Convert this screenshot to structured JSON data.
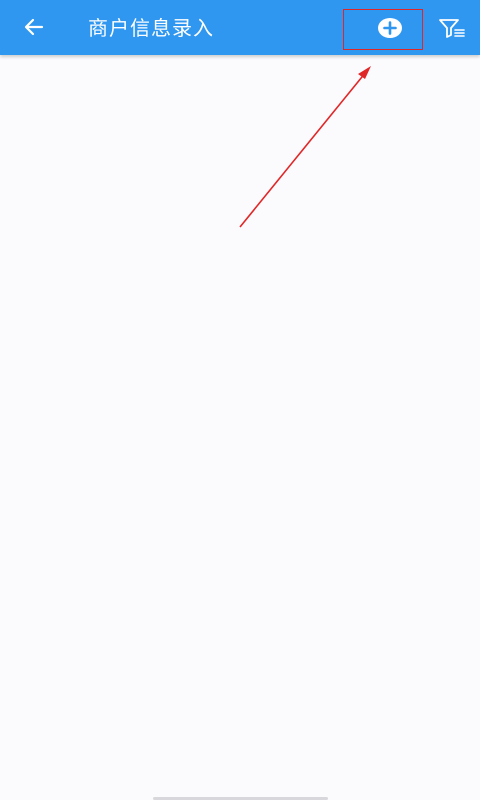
{
  "app_bar": {
    "title": "商户信息录入",
    "background_color": "#2f97f0",
    "back_icon": "arrow-left-icon",
    "add_icon": "plus-circle-icon",
    "filter_icon": "filter-list-icon"
  },
  "annotation": {
    "highlight_color": "#e02727",
    "target": "add-button"
  },
  "colors": {
    "page_background": "#fbfafd",
    "icon_color": "#ffffff"
  }
}
